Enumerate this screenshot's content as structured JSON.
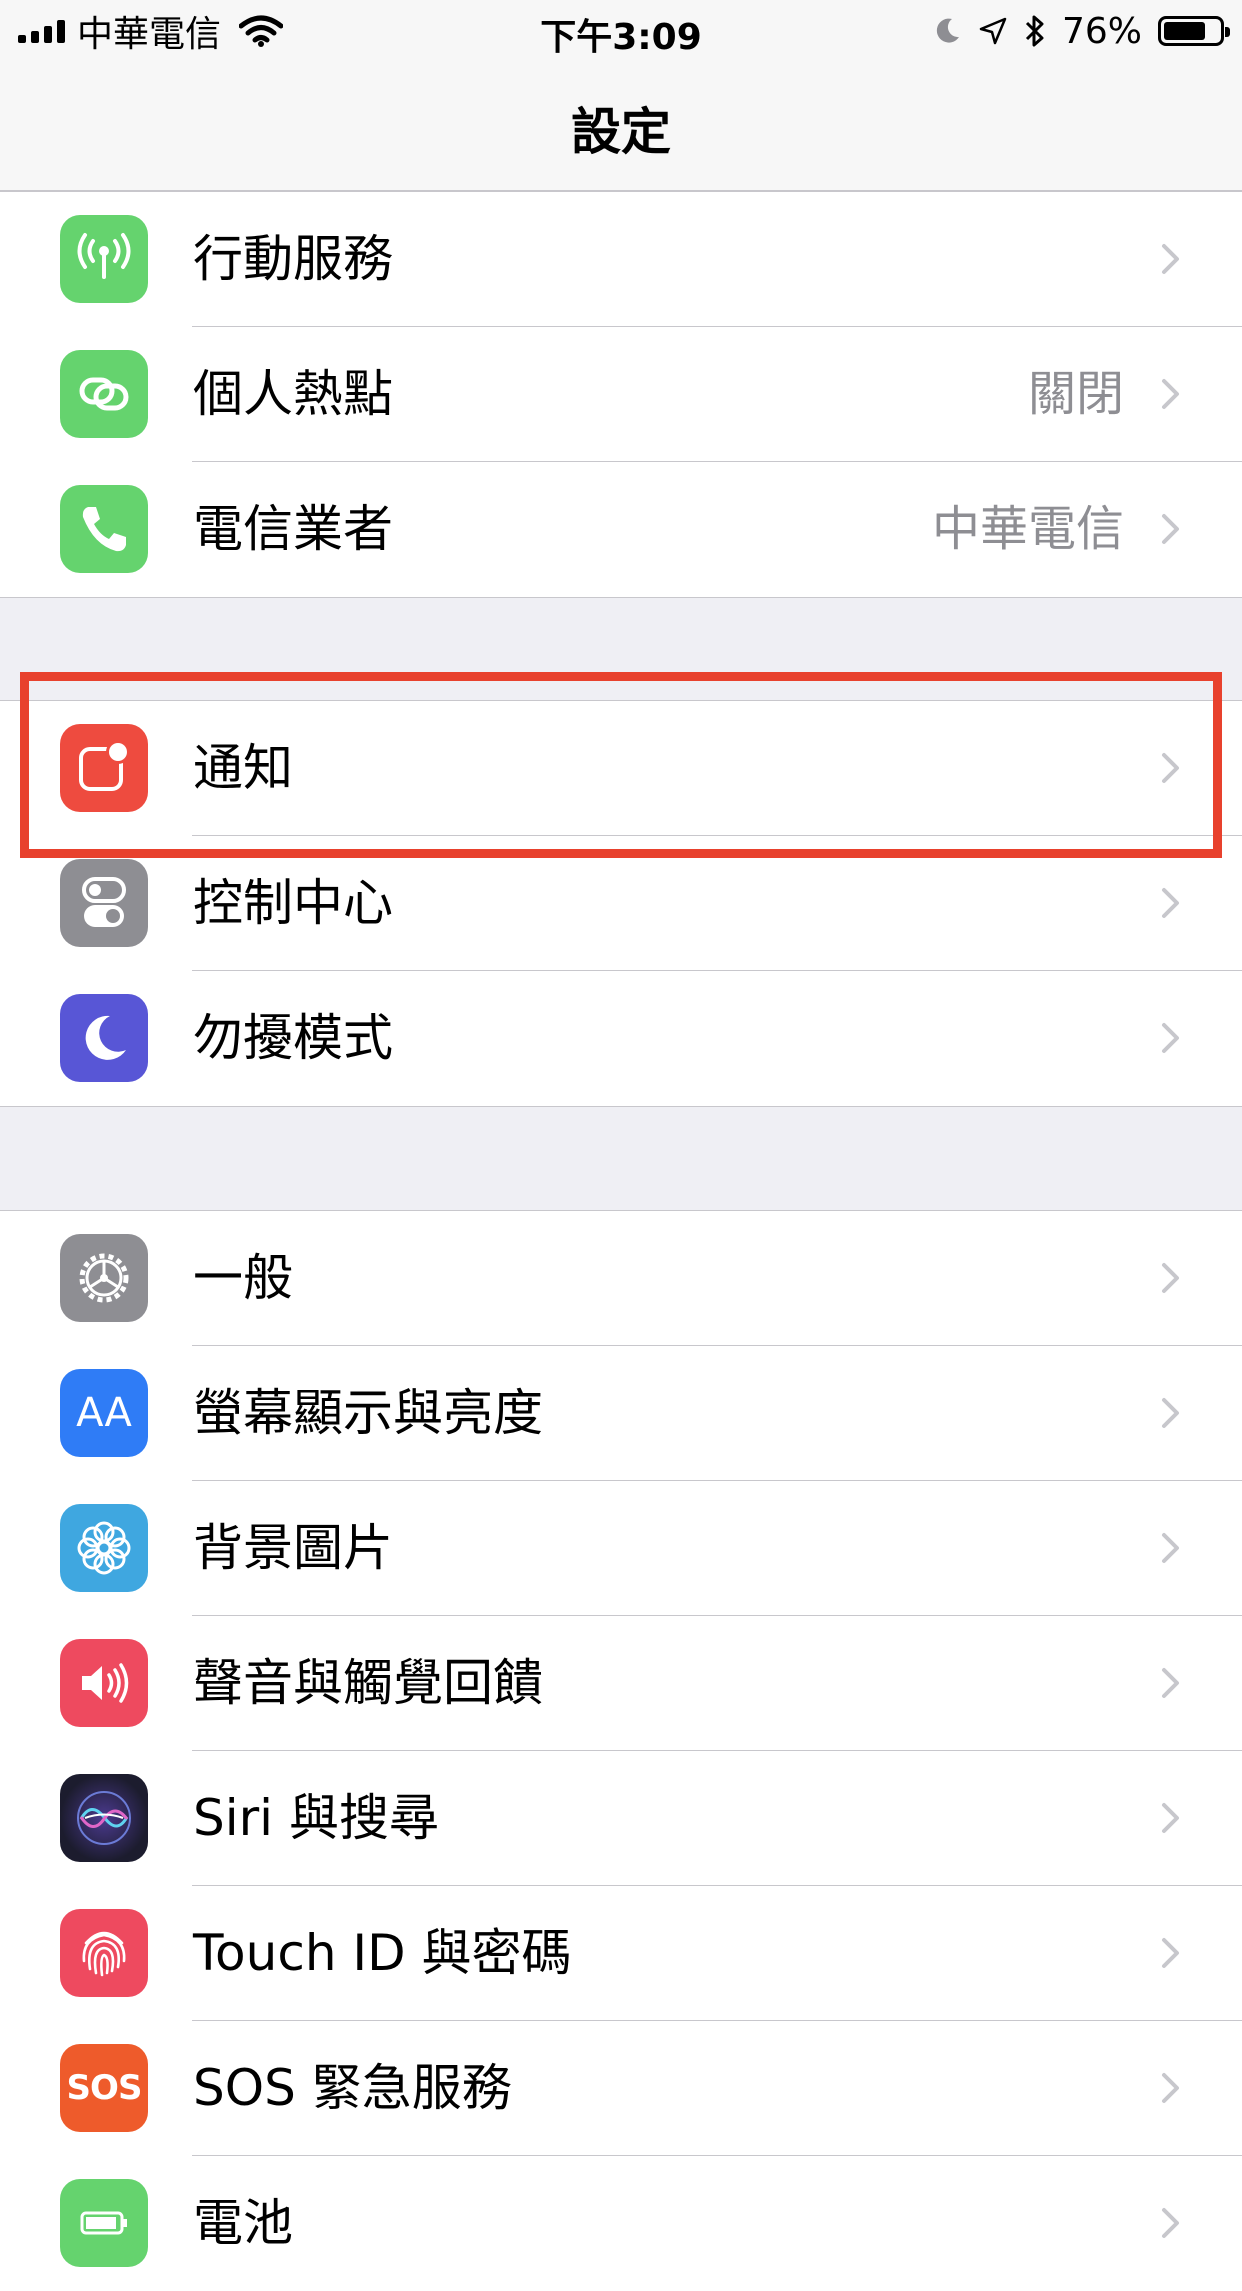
{
  "status_bar": {
    "carrier": "中華電信",
    "time": "下午3:09",
    "battery_percent": "76%",
    "battery_level": 0.76
  },
  "nav": {
    "title": "設定"
  },
  "sections": [
    {
      "rows": [
        {
          "label": "行動服務",
          "detail": "",
          "icon": "antenna-icon",
          "color": "#65d36e"
        },
        {
          "label": "個人熱點",
          "detail": "關閉",
          "icon": "hotspot-link-icon",
          "color": "#65d36e"
        },
        {
          "label": "電信業者",
          "detail": "中華電信",
          "icon": "phone-icon",
          "color": "#65d36e"
        }
      ]
    },
    {
      "rows": [
        {
          "label": "通知",
          "detail": "",
          "icon": "notification-icon",
          "color": "#ee4b3f"
        },
        {
          "label": "控制中心",
          "detail": "",
          "icon": "toggles-icon",
          "color": "#8e8e93"
        },
        {
          "label": "勿擾模式",
          "detail": "",
          "icon": "moon-icon",
          "color": "#5856d6"
        }
      ]
    },
    {
      "rows": [
        {
          "label": "一般",
          "detail": "",
          "icon": "gear-icon",
          "color": "#8e8e93"
        },
        {
          "label": "螢幕顯示與亮度",
          "detail": "",
          "icon": "text-size-icon",
          "color": "#2f7cf6",
          "icon_text": "AA"
        },
        {
          "label": "背景圖片",
          "detail": "",
          "icon": "flower-icon",
          "color": "#3fa7e0"
        },
        {
          "label": "聲音與觸覺回饋",
          "detail": "",
          "icon": "speaker-icon",
          "color": "#ee4a5f"
        },
        {
          "label": "Siri 與搜尋",
          "detail": "",
          "icon": "siri-icon",
          "color": "#1c1c2e"
        },
        {
          "label": "Touch ID 與密碼",
          "detail": "",
          "icon": "fingerprint-icon",
          "color": "#ee4a5f"
        },
        {
          "label": "SOS 緊急服務",
          "detail": "",
          "icon": "sos-icon",
          "color": "#ee5b2b",
          "icon_text": "SOS"
        },
        {
          "label": "電池",
          "detail": "",
          "icon": "battery-icon",
          "color": "#65d36e"
        }
      ]
    }
  ],
  "accent": {
    "highlight": "#e8412d",
    "separator": "#c8c7cc",
    "background": "#efeff4"
  }
}
